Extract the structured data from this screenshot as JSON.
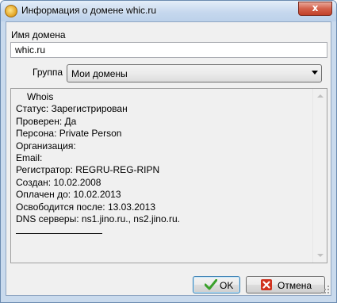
{
  "window": {
    "title": "Информация о домене whic.ru",
    "close_glyph": "x"
  },
  "domain": {
    "label": "Имя домена",
    "value": "whic.ru"
  },
  "group": {
    "label": "Группа",
    "selected": "Мои домены"
  },
  "whois": {
    "title": "Whois",
    "lines": [
      "Статус: Зарегистрирован",
      "Проверен: Да",
      "Персона: Private Person",
      "Организация:",
      "Email:",
      "Регистратор: REGRU-REG-RIPN",
      "Создан: 10.02.2008",
      "Оплачен до: 10.02.2013",
      "Освободится после: 13.03.2013",
      "DNS серверы: ns1.jino.ru., ns2.jino.ru."
    ]
  },
  "buttons": {
    "ok_label": "OK",
    "cancel_label": "Отмена"
  },
  "icons": {
    "app": "app-icon",
    "ok": "checkmark-icon",
    "cancel": "cross-icon",
    "close": "close-icon"
  },
  "colors": {
    "ok_icon": "#3aa12b",
    "cancel_icon": "#d0321e",
    "close_button": "#c84a33"
  }
}
